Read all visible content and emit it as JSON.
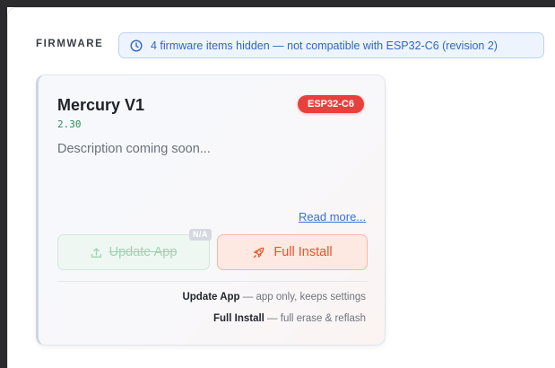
{
  "section": {
    "label": "FIRMWARE"
  },
  "notice": {
    "icon": "clock-icon",
    "text": "4 firmware items hidden — not compatible with ESP32-C6 (revision 2)"
  },
  "card": {
    "title": "Mercury V1",
    "version": "2.30",
    "chip": "ESP32-C6",
    "description": "Description coming soon...",
    "read_more": "Read more...",
    "update_button": {
      "label": "Update App",
      "icon": "upload-icon",
      "badge": "N/A",
      "disabled": true
    },
    "install_button": {
      "label": "Full Install",
      "icon": "rocket-icon"
    },
    "legend": [
      {
        "term": "Update App",
        "text": " — app only, keeps settings"
      },
      {
        "term": "Full Install",
        "text": " — full erase & reflash"
      }
    ]
  },
  "colors": {
    "accent_blue": "#2f66c9",
    "chip_red": "#e8413d",
    "install_orange": "#e2562c",
    "update_green": "#9fd3b4",
    "version_green": "#2e8b57"
  }
}
